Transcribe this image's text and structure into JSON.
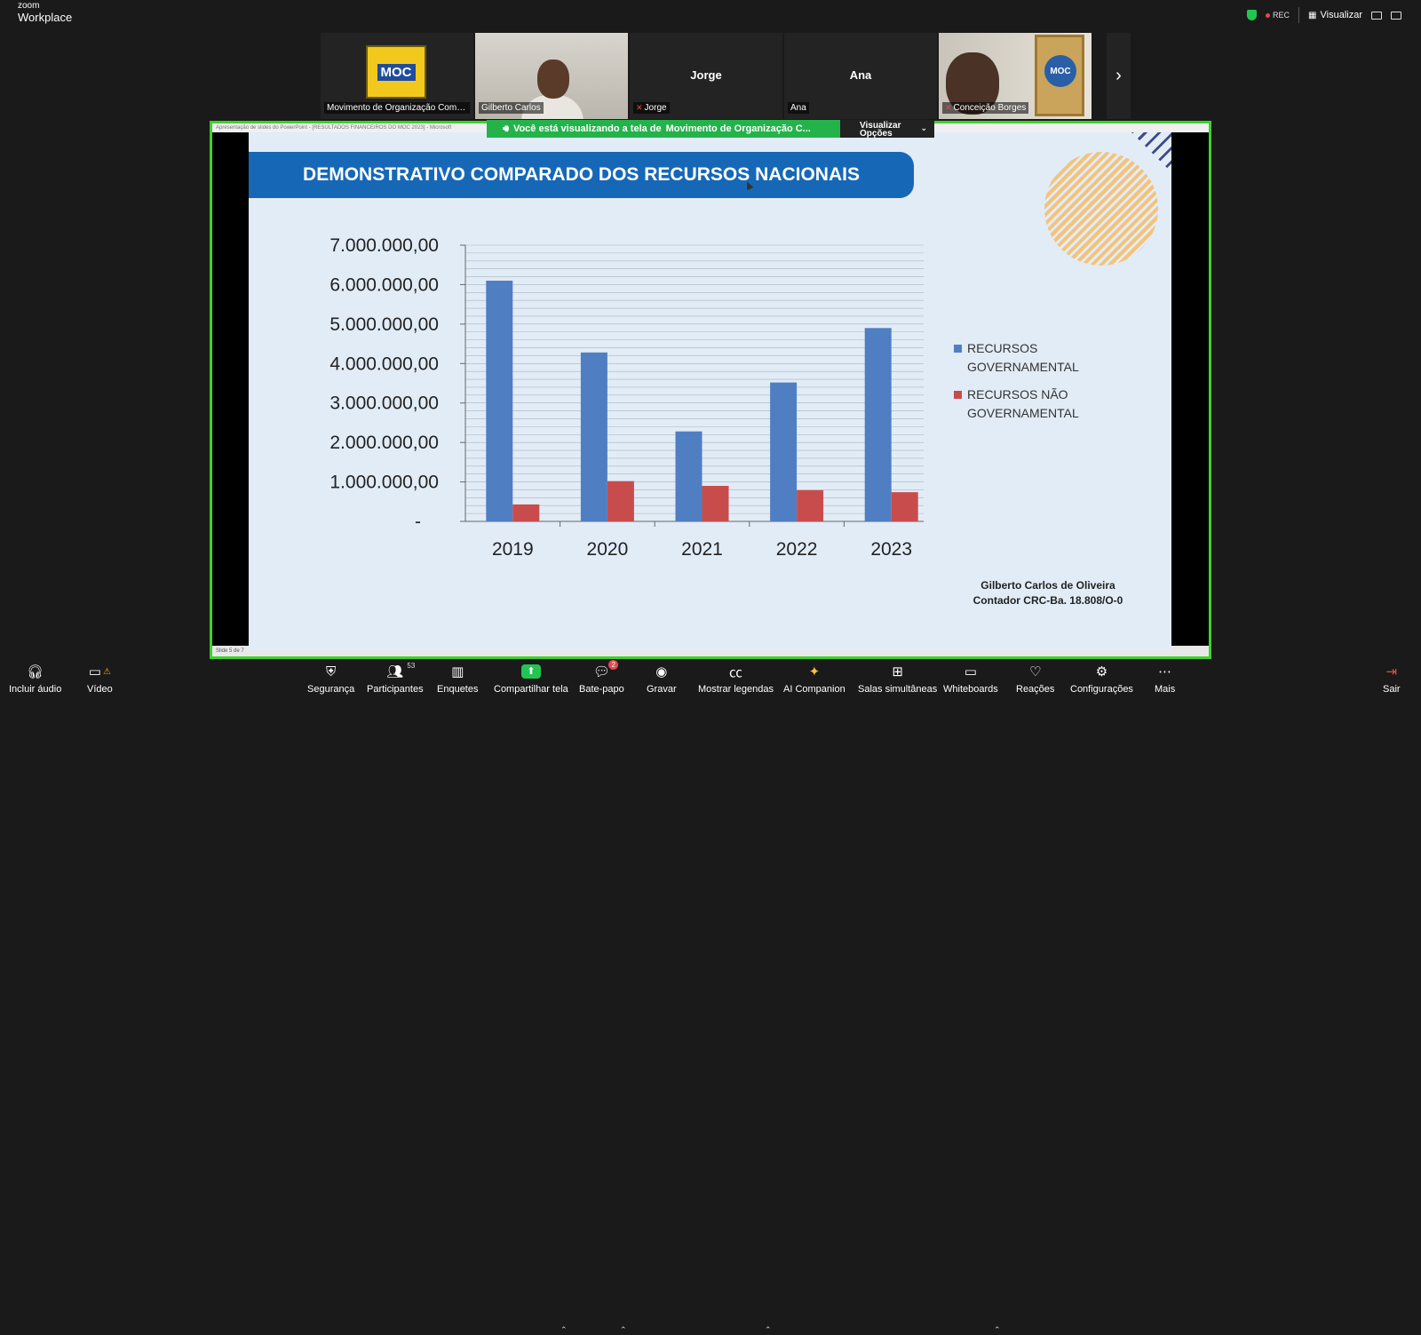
{
  "app": {
    "logo_top": "zoom",
    "logo_bottom": "Workplace"
  },
  "topbar": {
    "rec_label": "REC",
    "view_label": "Visualizar"
  },
  "participants_strip": [
    {
      "name": "Movimento de Organização Comun...",
      "type": "logo",
      "logo_text": "MOC"
    },
    {
      "name": "Gilberto Carlos",
      "type": "video"
    },
    {
      "name": "Jorge",
      "type": "name-only",
      "center_label": "Jorge",
      "muted": true
    },
    {
      "name": "Ana",
      "type": "name-only",
      "center_label": "Ana"
    },
    {
      "name": "Conceição Borges",
      "type": "video",
      "muted": true,
      "seal_text": "MOC"
    }
  ],
  "share": {
    "banner_text": "Você está visualizando a tela de",
    "banner_name": "Movimento de Organização C...",
    "view_options_line1": "Visualizar",
    "view_options_line2": "Opções",
    "ppt_title": "Apresentação de slides do PowerPoint - [RESULTADOS FINANCEIROS DO MOC 2023] - Microsoft",
    "status": "Slide 5 de 7"
  },
  "slide": {
    "title": "DEMONSTRATIVO COMPARADO DOS RECURSOS NACIONAIS",
    "signature_name": "Gilberto Carlos de Oliveira",
    "signature_role": "Contador CRC-Ba. 18.808/O-0"
  },
  "chart_data": {
    "type": "bar",
    "categories": [
      "2019",
      "2020",
      "2021",
      "2022",
      "2023"
    ],
    "series": [
      {
        "name": "RECURSOS GOVERNAMENTAL",
        "legend_line1": "RECURSOS",
        "legend_line2": "GOVERNAMENTAL",
        "color": "#4f7fc2",
        "values": [
          6100000,
          4280000,
          2280000,
          3520000,
          4900000
        ]
      },
      {
        "name": "RECURSOS NÃO GOVERNAMENTAL",
        "legend_line1": "RECURSOS NÃO",
        "legend_line2": "GOVERNAMENTAL",
        "color": "#c94c4c",
        "values": [
          430000,
          1020000,
          900000,
          790000,
          740000
        ]
      }
    ],
    "yticks": [
      "-",
      "1.000.000,00",
      "2.000.000,00",
      "3.000.000,00",
      "4.000.000,00",
      "5.000.000,00",
      "6.000.000,00",
      "7.000.000,00"
    ],
    "ylim": [
      0,
      7000000
    ],
    "grid": true,
    "legend_position": "right"
  },
  "toolbar": {
    "audio": "Incluir áudio",
    "video": "Vídeo",
    "security": "Segurança",
    "participants": "Participantes",
    "participants_count": "53",
    "polls": "Enquetes",
    "share": "Compartilhar tela",
    "chat": "Bate-papo",
    "chat_badge": "2",
    "record": "Gravar",
    "captions": "Mostrar legendas",
    "ai": "AI Companion",
    "breakout": "Salas simultâneas",
    "whiteboards": "Whiteboards",
    "reactions": "Reações",
    "settings": "Configurações",
    "more": "Mais",
    "leave": "Sair"
  }
}
